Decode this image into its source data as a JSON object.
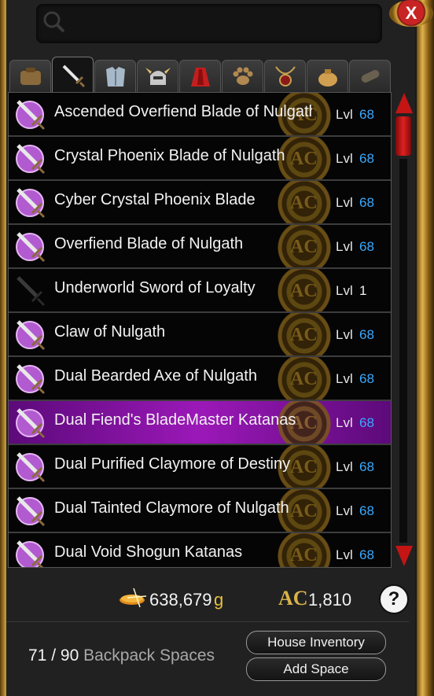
{
  "header": {
    "close_label": "X"
  },
  "tabs": [
    {
      "name": "bag",
      "active": false
    },
    {
      "name": "weapon",
      "active": true
    },
    {
      "name": "armor",
      "active": false
    },
    {
      "name": "helm",
      "active": false
    },
    {
      "name": "cape",
      "active": false
    },
    {
      "name": "pet",
      "active": false
    },
    {
      "name": "necklace",
      "active": false
    },
    {
      "name": "item",
      "active": false
    },
    {
      "name": "misc",
      "active": false
    }
  ],
  "items": [
    {
      "name": "Ascended Overfiend Blade of Nulgath",
      "lvl_label": "Lvl",
      "lvl": "68",
      "icon": "purple-sword-icon",
      "selected": false
    },
    {
      "name": "Crystal Phoenix Blade of Nulgath",
      "lvl_label": "Lvl",
      "lvl": "68",
      "icon": "purple-sword-icon",
      "selected": false
    },
    {
      "name": "Cyber Crystal Phoenix Blade",
      "lvl_label": "Lvl",
      "lvl": "68",
      "icon": "purple-sword-icon",
      "selected": false
    },
    {
      "name": "Overfiend Blade of Nulgath",
      "lvl_label": "Lvl",
      "lvl": "68",
      "icon": "purple-sword-icon",
      "selected": false
    },
    {
      "name": "Underworld Sword of Loyalty",
      "lvl_label": "Lvl",
      "lvl": "1",
      "icon": "dark-sword-icon",
      "selected": false
    },
    {
      "name": "Claw of Nulgath",
      "lvl_label": "Lvl",
      "lvl": "68",
      "icon": "purple-dagger-icon",
      "selected": false
    },
    {
      "name": "Dual Bearded Axe of Nulgath",
      "lvl_label": "Lvl",
      "lvl": "68",
      "icon": "purple-dagger-icon",
      "selected": false
    },
    {
      "name": "Dual Fiend's BladeMaster Katanas",
      "lvl_label": "Lvl",
      "lvl": "68",
      "icon": "purple-dagger-icon",
      "selected": true
    },
    {
      "name": "Dual Purified Claymore of Destiny",
      "lvl_label": "Lvl",
      "lvl": "68",
      "icon": "purple-dagger-icon",
      "selected": false
    },
    {
      "name": "Dual Tainted Claymore of Nulgath",
      "lvl_label": "Lvl",
      "lvl": "68",
      "icon": "purple-dagger-icon",
      "selected": false
    },
    {
      "name": "Dual Void Shogun Katanas",
      "lvl_label": "Lvl",
      "lvl": "68",
      "icon": "purple-dagger-icon",
      "selected": false
    }
  ],
  "ac_badge_text": "AC",
  "gold": {
    "value": "638,679",
    "unit": "g"
  },
  "ac_currency": {
    "icon_text": "AC",
    "value": "1,810"
  },
  "help_label": "?",
  "backpack": {
    "used": "71",
    "sep": "/",
    "max": "90",
    "label": "Backpack Spaces"
  },
  "buttons": {
    "house_inventory": "House Inventory",
    "add_space": "Add Space"
  },
  "colors": {
    "accent_purple": "#9b18b8",
    "level_blue": "#39a9ff",
    "gold": "#e6c040",
    "close_red": "#c82424"
  }
}
